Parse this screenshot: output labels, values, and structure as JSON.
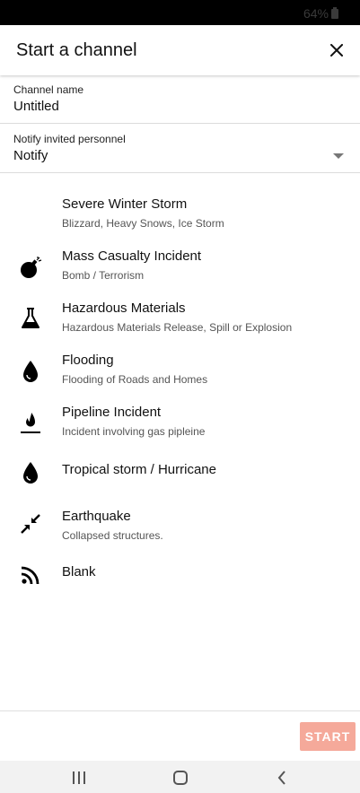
{
  "status_bar": {
    "battery_text": "64%",
    "icon": "battery-icon"
  },
  "app_bar": {
    "title": "Start a channel",
    "close_icon": "close-icon"
  },
  "channel_name": {
    "label": "Channel name",
    "value": "Untitled"
  },
  "notify": {
    "label": "Notify invited personnel",
    "value": "Notify",
    "icon": "dropdown-arrow-icon"
  },
  "templates": [
    {
      "title": "Severe Winter Storm",
      "subtitle": "Blizzard, Heavy Snows, Ice Storm",
      "icon": "none"
    },
    {
      "title": "Mass Casualty Incident",
      "subtitle": "Bomb / Terrorism",
      "icon": "bomb-icon"
    },
    {
      "title": "Hazardous Materials",
      "subtitle": "Hazardous Materials Release, Spill or Explosion",
      "icon": "flask-icon"
    },
    {
      "title": "Flooding",
      "subtitle": "Flooding of Roads and Homes",
      "icon": "water-drop-icon"
    },
    {
      "title": "Pipeline Incident",
      "subtitle": "Incident involving gas pipleine",
      "icon": "flame-icon"
    },
    {
      "title": "Tropical storm / Hurricane",
      "subtitle": "",
      "icon": "water-drop-icon"
    },
    {
      "title": "Earthquake",
      "subtitle": "Collapsed structures.",
      "icon": "collapse-arrows-icon"
    },
    {
      "title": "Blank",
      "subtitle": "",
      "icon": "rss-feed-icon"
    }
  ],
  "footer": {
    "start_label": "START",
    "start_color": "#f5a99a"
  },
  "nav_bar": {
    "recents_icon": "recents-icon",
    "home_icon": "home-icon",
    "back_icon": "back-icon"
  }
}
